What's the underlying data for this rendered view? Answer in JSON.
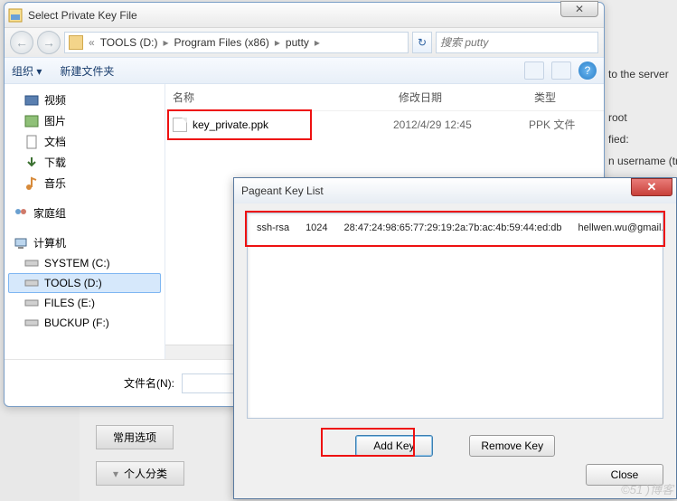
{
  "fileDialog": {
    "title": "Select Private Key File",
    "closeGlyph": "✕",
    "nav": {
      "backGlyph": "←",
      "fwdGlyph": "→"
    },
    "breadcrumb": {
      "chevGlyph": "«",
      "seg1": "TOOLS (D:)",
      "seg2": "Program Files (x86)",
      "seg3": "putty",
      "arrow": "▸",
      "refreshGlyph": "↻"
    },
    "search": {
      "placeholder": "搜索 putty"
    },
    "toolbar": {
      "organize": "组织 ▾",
      "newFolder": "新建文件夹"
    },
    "sidebar": {
      "video": "视频",
      "pictures": "图片",
      "documents": "文档",
      "downloads": "下载",
      "music": "音乐",
      "homegroup": "家庭组",
      "computer": "计算机",
      "driveC": "SYSTEM (C:)",
      "driveD": "TOOLS (D:)",
      "driveE": "FILES (E:)",
      "driveF": "BUCKUP (F:)"
    },
    "columns": {
      "name": "名称",
      "modified": "修改日期",
      "type": "类型"
    },
    "file": {
      "name": "key_private.ppk",
      "modified": "2012/4/29 12:45",
      "type": "PPK 文件"
    },
    "footer": {
      "label": "文件名(N):"
    }
  },
  "pageant": {
    "title": "Pageant Key List",
    "key": {
      "algo": "ssh-rsa",
      "bits": "1024",
      "fingerprint": "28:47:24:98:65:77:29:19:2a:7b:ac:4b:59:44:ed:db",
      "comment": "hellwen.wu@gmail.com"
    },
    "addKey": "Add Key",
    "removeKey": "Remove Key",
    "close": "Close"
  },
  "background": {
    "right1": "to the server",
    "right2": "root",
    "right3": "fied:",
    "right4": "n username (tran",
    "tab1": "常用选项",
    "tab2": "个人分类"
  },
  "watermark": "©51 )博客"
}
